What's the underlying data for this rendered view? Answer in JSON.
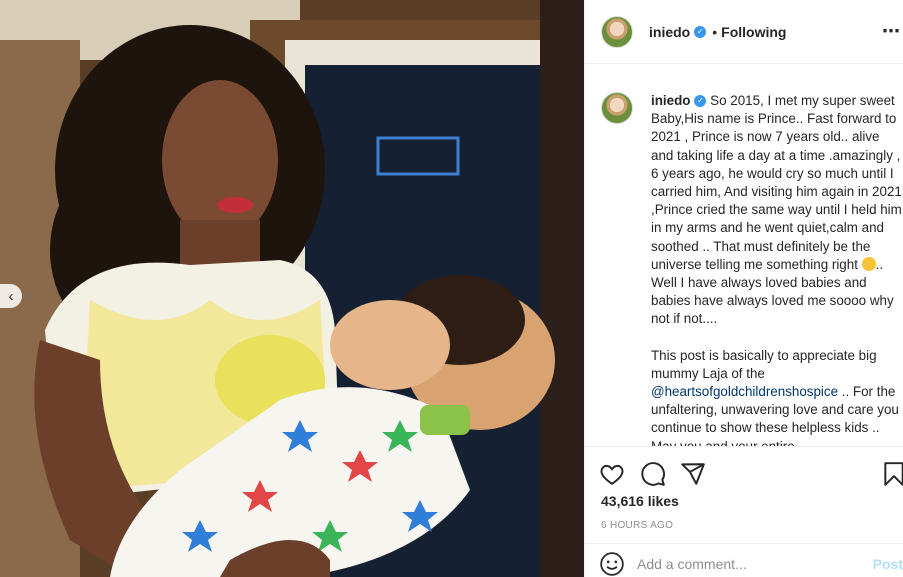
{
  "post": {
    "author": "iniedo",
    "follow_separator": "•",
    "follow_status": "Following",
    "more_icon": "⋯",
    "verified_glyph": "✓"
  },
  "caption": {
    "username": "iniedo",
    "paragraph1_a": " So 2015, I met my super sweet Baby,His name is Prince.. Fast forward to 2021 , Prince is now 7 years old.. alive and taking life a day at a time .amazingly , 6 years ago, he would cry so much until I carried him, And visiting him again in 2021 ,Prince cried the same way until I held him in my arms and he went quiet,calm and soothed .. That must definitely be the universe telling me something right ",
    "paragraph1_b": ".. Well I have always loved babies and babies have always loved me soooo why not if not....",
    "paragraph2_a": "This post is basically to appreciate big mummy Laja of the ",
    "mention": "@heartsofgoldchildrenshospice",
    "paragraph2_b": " .. For the unfaltering, unwavering love and care you continue to show these helpless kids .. May you and your entire"
  },
  "stats": {
    "likes": "43,616 likes",
    "time": "6 HOURS AGO"
  },
  "comment": {
    "placeholder": "Add a comment...",
    "post_label": "Post"
  },
  "nav": {
    "prev_glyph": "‹"
  },
  "colors": {
    "verified": "#3897f0",
    "link": "#00376b",
    "post_disabled": "#b2dffc"
  }
}
